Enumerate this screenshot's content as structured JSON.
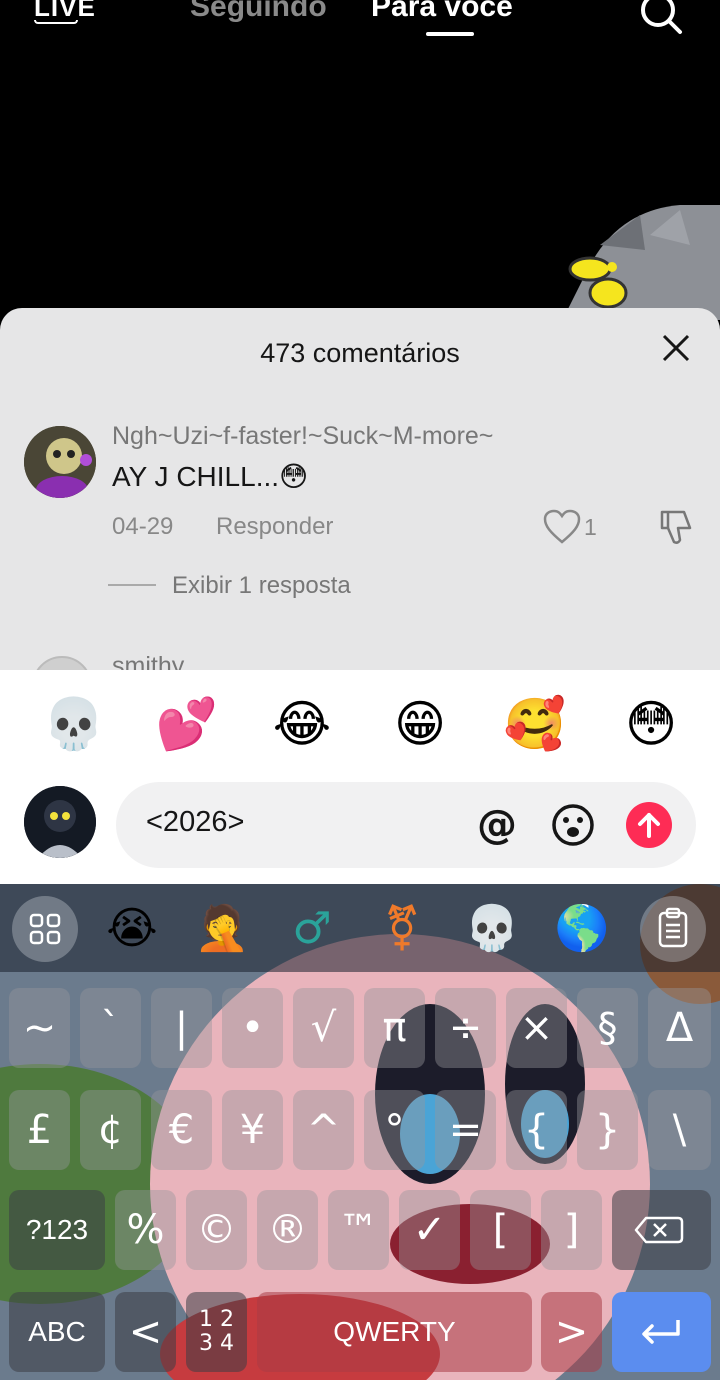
{
  "top_nav": {
    "live_label": "LIVE",
    "tabs": [
      {
        "label": "Seguindo",
        "active": false
      },
      {
        "label": "Para você",
        "active": true
      }
    ]
  },
  "comments": {
    "title": "473 comentários",
    "items": [
      {
        "username": "Ngh~Uzi~f-faster!~Suck~M-more~",
        "text": "AY J CHILL...😳",
        "date": "04-29",
        "reply_label": "Responder",
        "likes": "1",
        "replies_label": "Exibir 1 resposta"
      },
      {
        "username": "smithy"
      }
    ]
  },
  "composer": {
    "quick_emojis": [
      "💀",
      "💕",
      "😂",
      "😁",
      "🥰",
      "😳"
    ],
    "input_value": "<2026>",
    "mention_symbol": "@",
    "send_color": "#fe2c55"
  },
  "keyboard": {
    "toolbar_emojis": [
      "😭",
      "🤦",
      "♂",
      "⚧",
      "💀",
      "🌎"
    ],
    "row1": [
      "~",
      "`",
      "|",
      "•",
      "√",
      "π",
      "÷",
      "×",
      "§",
      "Δ"
    ],
    "row2": [
      "£",
      "¢",
      "€",
      "¥",
      "^",
      "°",
      "=",
      "{",
      "}",
      "\\"
    ],
    "row3": {
      "mode_key": "?123",
      "keys": [
        "%",
        "©",
        "®",
        "™",
        "✓",
        "[",
        "]"
      ]
    },
    "row4": {
      "abc_key": "ABC",
      "lt_key": "<",
      "num_key_top": "1 2",
      "num_key_bottom": "3 4",
      "space_key": "QWERTY",
      "gt_key": ">"
    }
  },
  "colors": {
    "accent": "#fe2c55",
    "sheet_bg": "#e6e6e7",
    "enter_key": "#5b8def"
  }
}
